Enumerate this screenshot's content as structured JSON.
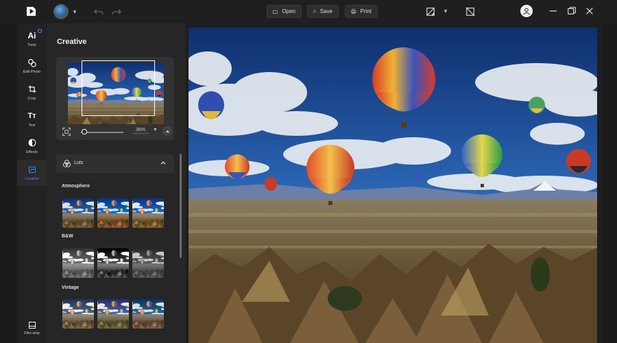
{
  "toolbar": {
    "open_label": "Open",
    "save_label": "Save",
    "print_label": "Print"
  },
  "rail": {
    "items": [
      {
        "label": "Tools",
        "icon": "ai-icon"
      },
      {
        "label": "Edit Photo",
        "icon": "edit-photo-icon"
      },
      {
        "label": "Crop",
        "icon": "crop-icon"
      },
      {
        "label": "Text",
        "icon": "text-icon"
      },
      {
        "label": "Effects",
        "icon": "effects-icon"
      },
      {
        "label": "Creative",
        "icon": "creative-icon",
        "active": true
      }
    ],
    "ai_label": "Ai",
    "text_glyph": "Tт",
    "film_strip_label": "Film-strip"
  },
  "panel": {
    "title": "Creative",
    "zoom_value": "36%",
    "luts_label": "Luts",
    "sections": [
      {
        "title": "Atmosphere",
        "filters": [
          "normal",
          "cool",
          "warm"
        ]
      },
      {
        "title": "B&W",
        "filters": [
          "bw-light",
          "bw-contrast",
          "bw-soft"
        ]
      },
      {
        "title": "Vintage",
        "filters": [
          "vintage-1",
          "vintage-2",
          "vintage-3"
        ]
      }
    ],
    "zoom_fraction": 0.36
  },
  "colors": {
    "accent": "#3a8df0",
    "background": "#1b1b1b",
    "panel": "#262626"
  }
}
